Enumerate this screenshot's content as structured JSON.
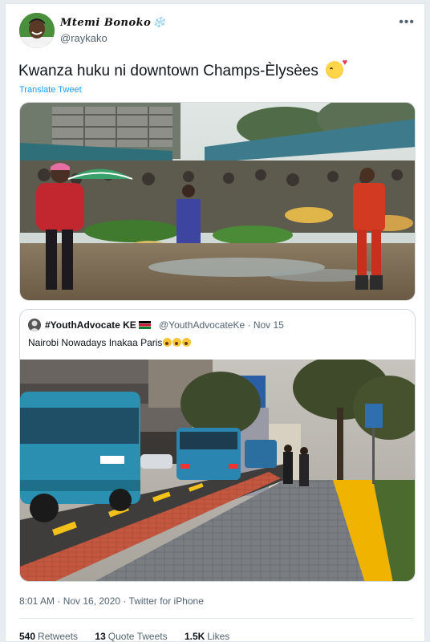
{
  "author": {
    "display_name": "Mtemi Bonoko",
    "badge_glyph": "❄️",
    "handle": "@raykako",
    "avatar_icon": "profile-avatar"
  },
  "more_glyph": "•••",
  "tweet": {
    "text": "Kwanza huku ni downtown Champs-Èlysèes",
    "emoji": "smiling-face-with-hearts",
    "translate_label": "Translate Tweet",
    "photo_alt": "market-photo"
  },
  "quoted": {
    "name": "#YouthAdvocate KE",
    "flag": "kenya-flag",
    "handle_date": "@YouthAdvocateKe · Nov 15",
    "text": "Nairobi Nowadays Inakaa Paris",
    "emoji": "astonished-face",
    "photo_alt": "street-photo"
  },
  "meta": {
    "timestamp": "8:01 AM · Nov 16, 2020 · Twitter for iPhone"
  },
  "stats": {
    "retweets_count": "540",
    "retweets_label": "Retweets",
    "quotes_count": "13",
    "quotes_label": "Quote Tweets",
    "likes_count": "1.5K",
    "likes_label": "Likes"
  },
  "colors": {
    "link": "#1d9bf0",
    "secondary_text": "#536471",
    "bus_blue": "#2a8fb0"
  }
}
